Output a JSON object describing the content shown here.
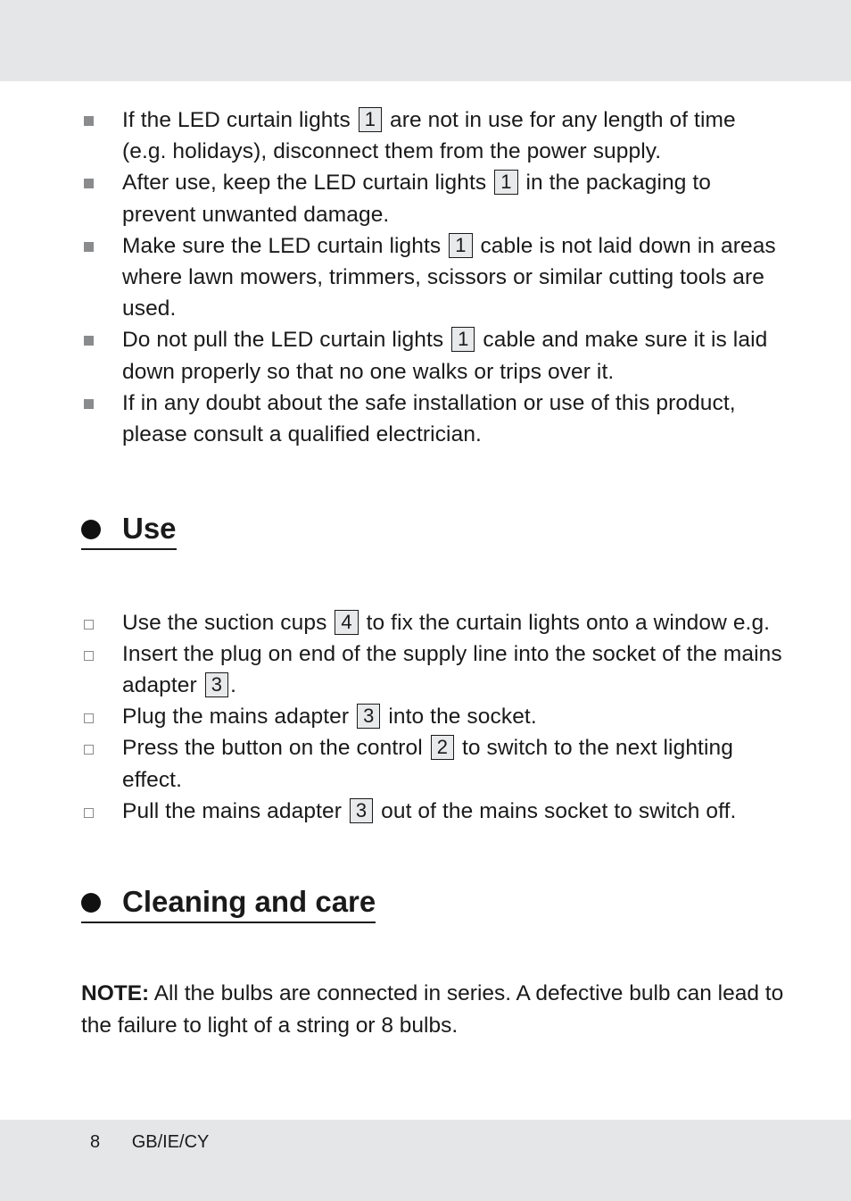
{
  "colors": {
    "band": "#e5e6e8",
    "text": "#1a1a1a",
    "bullet": "#8a8b8d"
  },
  "safety_list": [
    {
      "before": "If the LED curtain lights",
      "ref": "1",
      "after": "are not in use for any length of time (e.g. holidays), disconnect them from the power supply."
    },
    {
      "before": "After use, keep the LED curtain lights",
      "ref": "1",
      "after": "in the packaging to prevent unwanted damage."
    },
    {
      "before": "Make sure the LED curtain lights",
      "ref": "1",
      "after": "cable is not laid down in areas where lawn mowers, trimmers, scissors or similar cutting tools are used."
    },
    {
      "before": "Do not pull the LED curtain lights",
      "ref": "1",
      "after": "cable and make sure it is laid down properly so that no one walks or trips over it."
    },
    {
      "before": "If in any doubt about the safe installation or use of this product, please consult a qualified electrician.",
      "ref": null,
      "after": ""
    }
  ],
  "use_section": {
    "heading": "Use",
    "steps": [
      {
        "before": "Use the suction cups",
        "ref": "4",
        "after": "to fix the curtain lights onto a window e.g."
      },
      {
        "before": "Insert the plug on end of the supply line into the socket of the mains adapter",
        "ref": "3",
        "after": "."
      },
      {
        "before": "Plug the mains adapter",
        "ref": "3",
        "after": "into the socket."
      },
      {
        "before": "Press the button on the control",
        "ref": "2",
        "after": "to switch to the next lighting effect."
      },
      {
        "before": "Pull the mains adapter",
        "ref": "3",
        "after": "out of the mains socket to switch off."
      }
    ]
  },
  "care_section": {
    "heading": "Cleaning and care",
    "note_label": "NOTE:",
    "note_text": "All the bulbs are connected in series. A defective bulb can lead to the failure to light of a string or 8 bulbs."
  },
  "footer": {
    "page_number": "8",
    "region": "GB/IE/CY"
  }
}
